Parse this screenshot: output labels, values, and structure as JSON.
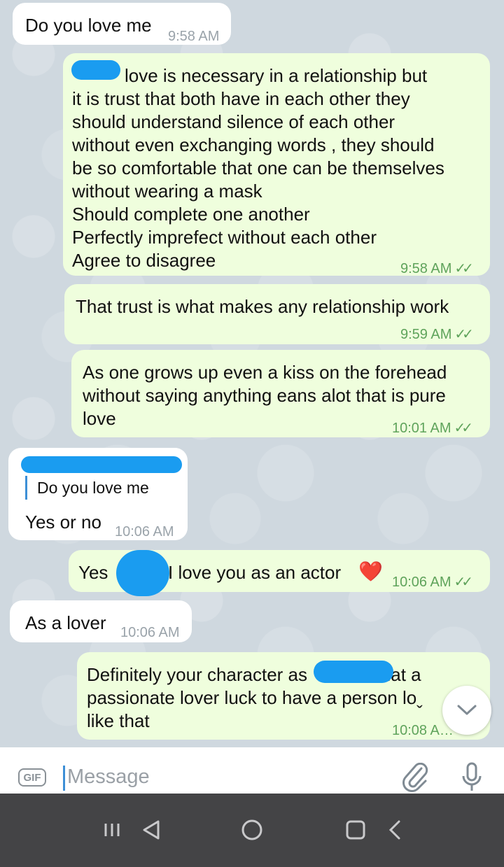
{
  "messages": [
    {
      "text": "Do you love me",
      "time": "9:58 AM"
    },
    {
      "lines": [
        "love is necessary in a relationship but",
        "it is trust that both have in each other they",
        "should understand silence of each other",
        "without even exchanging words , they should",
        "be so comfortable that one can be themselves",
        "without wearing a mask",
        "Should complete one another",
        "Perfectly imprefect without each other",
        "Agree to disagree"
      ],
      "time": "9:58 AM"
    },
    {
      "text": "That trust is what makes any relationship work",
      "time": "9:59 AM"
    },
    {
      "lines": [
        "As one grows up even a kiss on the forehead",
        "without saying anything eans alot that is pure",
        "love"
      ],
      "time": "10:01 AM"
    },
    {
      "reply_quote": "Do you love me",
      "text": "Yes or no",
      "time": "10:06 AM"
    },
    {
      "text_start": "Yes",
      "text_end": "I love you as an actor",
      "emoji": "❤️",
      "time": "10:06 AM"
    },
    {
      "text": "As a lover",
      "time": "10:06 AM"
    },
    {
      "line1_start": "Definitely your character as",
      "line1_end": "what a",
      "line2": "passionate lover luck to have a person loˬ",
      "line3": "like that",
      "time": "10:08 A…"
    }
  ],
  "input": {
    "placeholder": "Message",
    "gif_label": "GIF"
  },
  "icons": {
    "attach": "paperclip-icon",
    "mic": "microphone-icon",
    "scroll": "chevron-down-icon"
  },
  "colors": {
    "incoming": "#ffffff",
    "outgoing": "#effedd",
    "accent": "#3d8fd6",
    "tick": "#5fa35b"
  }
}
